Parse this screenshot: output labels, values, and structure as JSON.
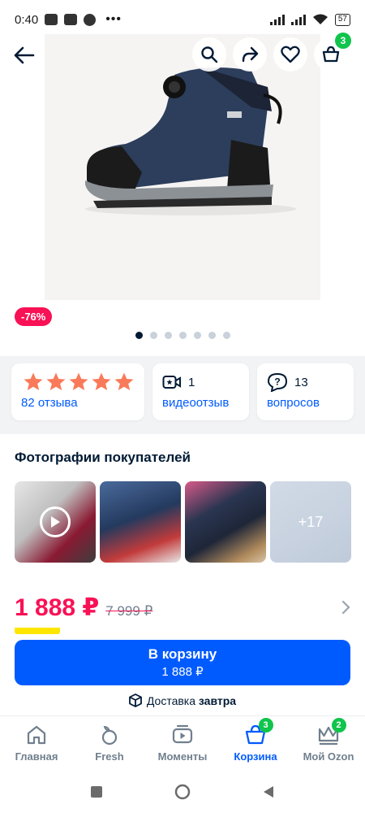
{
  "status_bar": {
    "time": "0:40",
    "battery": "57"
  },
  "product": {
    "discount_badge": "-76%"
  },
  "top_bar": {
    "cart_count": "3"
  },
  "gallery": {
    "total_slides": 7,
    "active_slide": 1
  },
  "info_cards": {
    "rating": {
      "stars": 5,
      "reviews_label": "82 отзыва"
    },
    "video": {
      "count": "1",
      "label": "видеоотзыв"
    },
    "questions": {
      "count": "13",
      "label": "вопросов"
    }
  },
  "customer_photos": {
    "title": "Фотографии покупателей",
    "more_label": "+17"
  },
  "price": {
    "current": "1 888 ₽",
    "old": "7 999 ₽"
  },
  "buy_button": {
    "label": "В корзину",
    "price": "1 888 ₽"
  },
  "delivery": {
    "text": "Доставка ",
    "highlight": "завтра"
  },
  "bottom_nav": {
    "items": [
      {
        "label": "Главная"
      },
      {
        "label": "Fresh"
      },
      {
        "label": "Моменты"
      },
      {
        "label": "Корзина",
        "badge": "3"
      },
      {
        "label": "Мой Ozon",
        "badge": "2"
      }
    ]
  },
  "colors": {
    "accent": "#005bff",
    "price": "#f91155",
    "badge": "#10c44c"
  }
}
